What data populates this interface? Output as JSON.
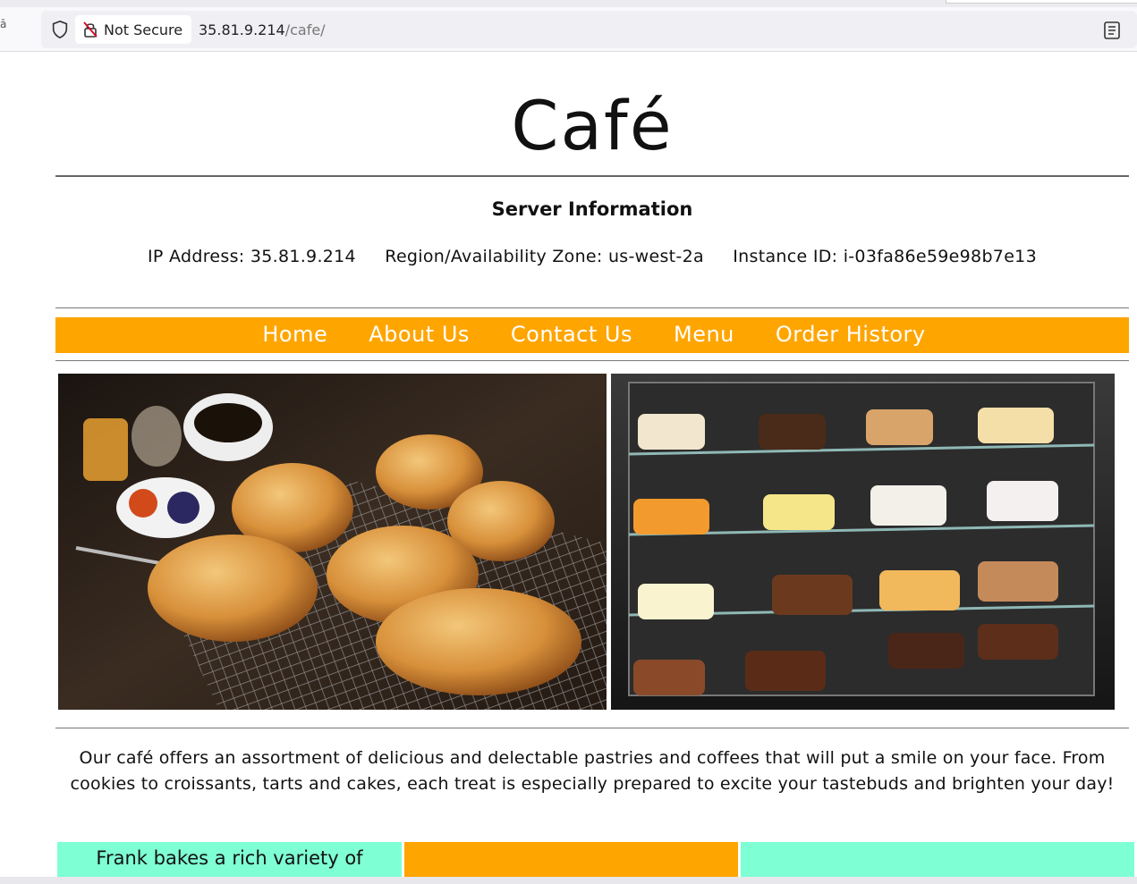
{
  "browser": {
    "security_label": "Not Secure",
    "url_host": "35.81.9.214",
    "url_path": "/cafe/"
  },
  "site": {
    "title": "Café"
  },
  "server": {
    "heading": "Server Information",
    "ip": "IP Address: 35.81.9.214",
    "region": "Region/Availability Zone: us-west-2a",
    "instance": "Instance ID: i-03fa86e59e98b7e13"
  },
  "nav": {
    "items": [
      "Home",
      "About Us",
      "Contact Us",
      "Menu",
      "Order History"
    ]
  },
  "intro": {
    "text": "Our café offers an assortment of delicious and delectable pastries and coffees that will put a smile on your face. From cookies to croissants, tarts and cakes, each treat is especially prepared to excite your tastebuds and brighten your day!"
  },
  "cards": {
    "first_text": "Frank bakes a rich variety of"
  },
  "colors": {
    "nav_bg": "#ffa500",
    "card_aqua": "#7fffd4",
    "card_orange": "#ffa500"
  }
}
